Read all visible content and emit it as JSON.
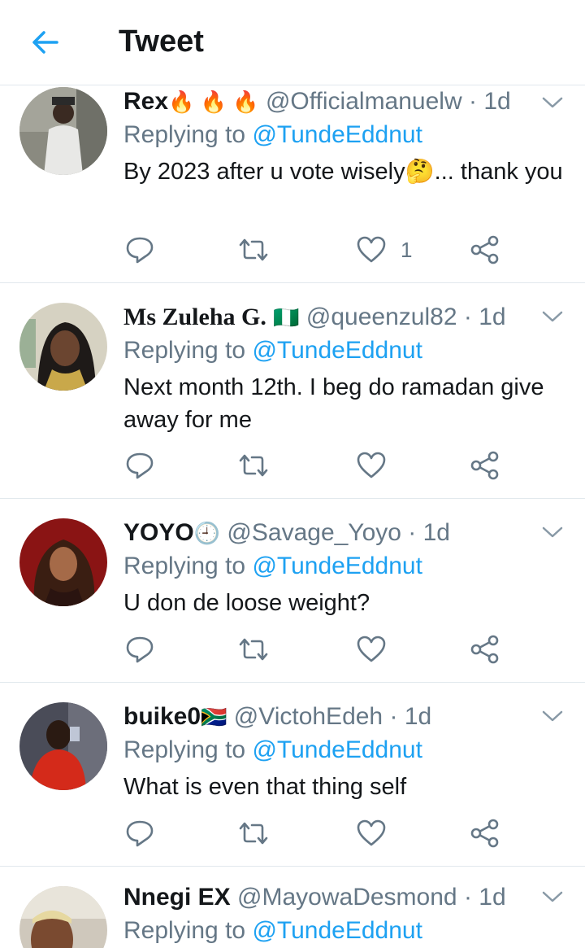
{
  "header": {
    "title": "Tweet"
  },
  "replying_prefix": "Replying to",
  "tweets": [
    {
      "name": "Rex",
      "name_emoji": "🔥 🔥 🔥",
      "handle": "@Officialmanuelw",
      "dot": "·",
      "time": "1d",
      "reply_to": "@TundeEddnut",
      "text": "By 2023 after u vote wisely🤔... thank you",
      "like_count": "1"
    },
    {
      "name": "Ms Zuleha G.",
      "name_emoji": "🇳🇬",
      "handle": "@queenzul82",
      "dot": "·",
      "time": "1d",
      "reply_to": "@TundeEddnut",
      "text": "Next month 12th. I beg do ramadan give away for me"
    },
    {
      "name": "YOYO",
      "name_emoji": "🕘",
      "handle": "@Savage_Yoyo",
      "dot": "·",
      "time": "1d",
      "reply_to": "@TundeEddnut",
      "text": "U don de loose weight?"
    },
    {
      "name": "buike0",
      "name_emoji": "🇿🇦",
      "handle": "@VictohEdeh",
      "dot": "·",
      "time": "1d",
      "reply_to": "@TundeEddnut",
      "text": "What is even that thing self"
    },
    {
      "name": "Nnegi EX",
      "handle": "@MayowaDesmond",
      "dot": "·",
      "time": "1d",
      "reply_to": "@TundeEddnut"
    }
  ],
  "colors": {
    "accent": "#1da1f2",
    "secondary_text": "#657786",
    "divider": "#e1e8ed"
  },
  "icons": [
    "back-arrow-icon",
    "chevron-down-icon",
    "reply-icon",
    "retweet-icon",
    "like-icon",
    "share-icon"
  ]
}
